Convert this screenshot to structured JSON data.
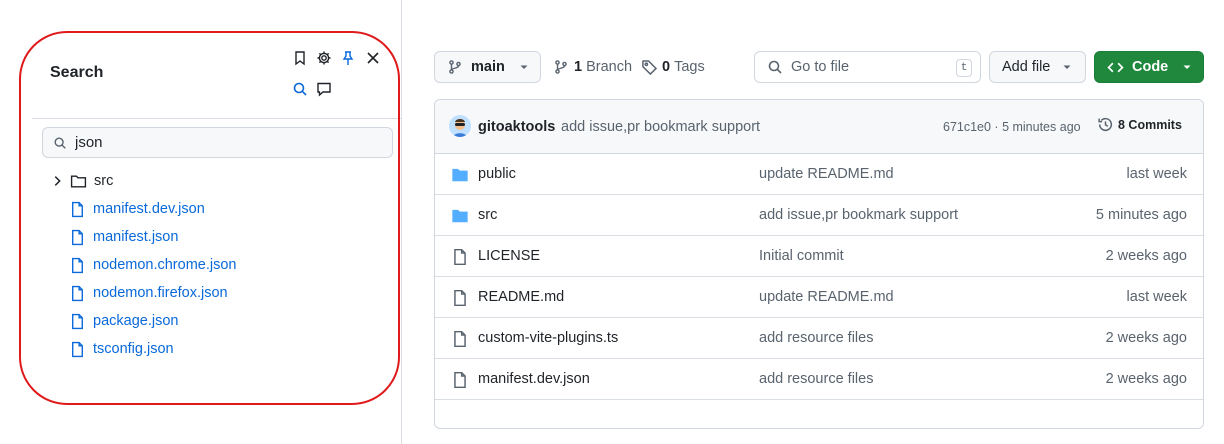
{
  "sidebar": {
    "title": "Search",
    "icons": [
      "bookmark-icon",
      "gear-icon",
      "pin-icon",
      "close-icon",
      "search-icon",
      "comment-icon"
    ],
    "search": {
      "value": "json"
    },
    "tree": [
      {
        "label": "src",
        "type": "folder"
      },
      {
        "label": "manifest.dev.json",
        "type": "file"
      },
      {
        "label": "manifest.json",
        "type": "file"
      },
      {
        "label": "nodemon.chrome.json",
        "type": "file"
      },
      {
        "label": "nodemon.firefox.json",
        "type": "file"
      },
      {
        "label": "package.json",
        "type": "file"
      },
      {
        "label": "tsconfig.json",
        "type": "file"
      }
    ]
  },
  "toolbar": {
    "branch_selected": "main",
    "branch_count": "1",
    "branch_label": "Branch",
    "tag_count": "0",
    "tag_label": "Tags",
    "goto_placeholder": "Go to file",
    "goto_shortcut": "t",
    "add_file_label": "Add file",
    "code_label": "Code"
  },
  "commit": {
    "author": "gitoaktools",
    "message": "add issue,pr bookmark support",
    "meta": "671c1e0 · 5 minutes ago",
    "commits_label": "8 Commits"
  },
  "files": [
    {
      "name": "public",
      "type": "folder",
      "message": "update README.md",
      "age": "last week"
    },
    {
      "name": "src",
      "type": "folder",
      "message": "add issue,pr bookmark support",
      "age": "5 minutes ago"
    },
    {
      "name": "LICENSE",
      "type": "file",
      "message": "Initial commit",
      "age": "2 weeks ago"
    },
    {
      "name": "README.md",
      "type": "file",
      "message": "update README.md",
      "age": "last week"
    },
    {
      "name": "custom-vite-plugins.ts",
      "type": "file",
      "message": "add resource files",
      "age": "2 weeks ago"
    },
    {
      "name": "manifest.dev.json",
      "type": "file",
      "message": "add resource files",
      "age": "2 weeks ago"
    }
  ],
  "colors": {
    "accent_blue": "#0969da",
    "code_green": "#1f883d",
    "highlight_red": "#e0191b",
    "folder_blue": "#54aeff"
  }
}
